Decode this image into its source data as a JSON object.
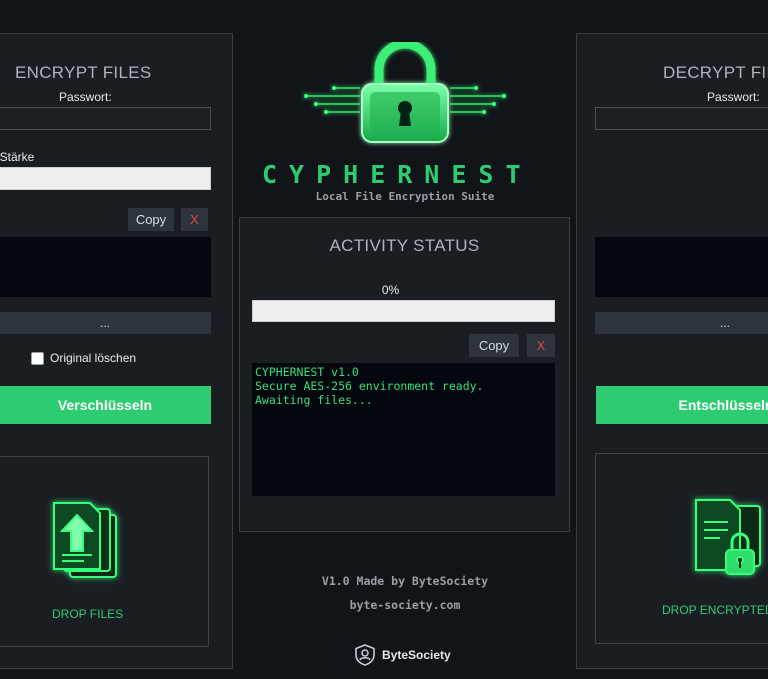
{
  "encrypt": {
    "title": "ENCRYPT FILES",
    "password_label": "Passwort:",
    "strength_label": "Stärke",
    "copy_label": "Copy",
    "clear_label": "X",
    "browse_label": "...",
    "delete_original_label": "Original löschen",
    "delete_original_checked": false,
    "action_label": "Verschlüsseln",
    "drop_label": "DROP FILES"
  },
  "decrypt": {
    "title": "DECRYPT FILE",
    "password_label": "Passwort:",
    "browse_label": "...",
    "action_label": "Entschlüsseln",
    "drop_label": "DROP ENCRYPTED F"
  },
  "brand": {
    "name": "CYPHERNEST",
    "tagline": "Local File Encryption Suite"
  },
  "activity": {
    "title": "ACTIVITY STATUS",
    "progress_text": "0%",
    "progress_value": 0,
    "copy_label": "Copy",
    "clear_label": "X",
    "log": [
      "CYPHERNEST v1.0",
      "Secure AES-256 environment ready.",
      "Awaiting files..."
    ]
  },
  "footer": {
    "version_line": "V1.0 Made by ByteSociety",
    "website": "byte-society.com",
    "logo_text": "ByteSociety"
  },
  "colors": {
    "accent_green": "#2ecc71",
    "log_green": "#35e07a",
    "danger_red": "#e0473f",
    "background": "#111418"
  },
  "icons": {
    "brand": "padlock-circuit-icon",
    "encrypt_drop": "file-upload-icon",
    "decrypt_drop": "locked-file-icon",
    "footer": "bytesociety-logo-icon"
  }
}
